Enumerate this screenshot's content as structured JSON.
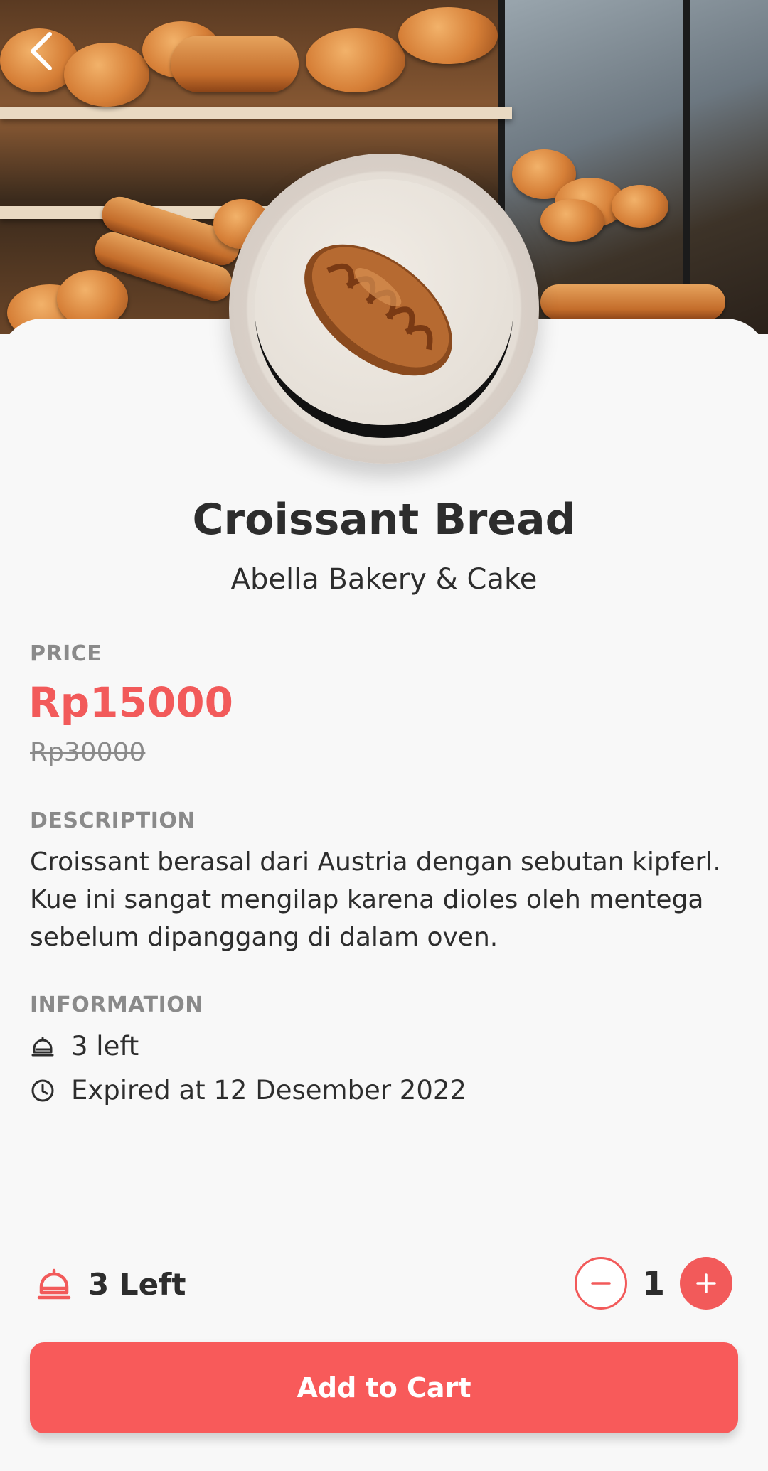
{
  "header": {
    "back_icon": "chevron-left-icon"
  },
  "product": {
    "title": "Croissant Bread",
    "store": "Abella Bakery & Cake"
  },
  "price": {
    "label": "PRICE",
    "current": "Rp15000",
    "original": "Rp30000"
  },
  "description": {
    "label": "DESCRIPTION",
    "text": "Croissant berasal dari Austria dengan sebutan kipferl. Kue ini sangat mengilap karena dioles oleh mentega sebelum dipanggang di dalam oven."
  },
  "information": {
    "label": "INFORMATION",
    "items": [
      {
        "icon": "bell-icon",
        "text": "3 left"
      },
      {
        "icon": "clock-icon",
        "text": "Expired at 12 Desember 2022"
      }
    ]
  },
  "bottom": {
    "stock_icon": "bell-icon",
    "stock_text": "3 Left",
    "quantity": "1",
    "add_to_cart_label": "Add to Cart"
  },
  "colors": {
    "accent": "#F85A5A",
    "muted": "#8A8A8A",
    "text": "#2D2D2D",
    "background": "#F8F8F8"
  }
}
